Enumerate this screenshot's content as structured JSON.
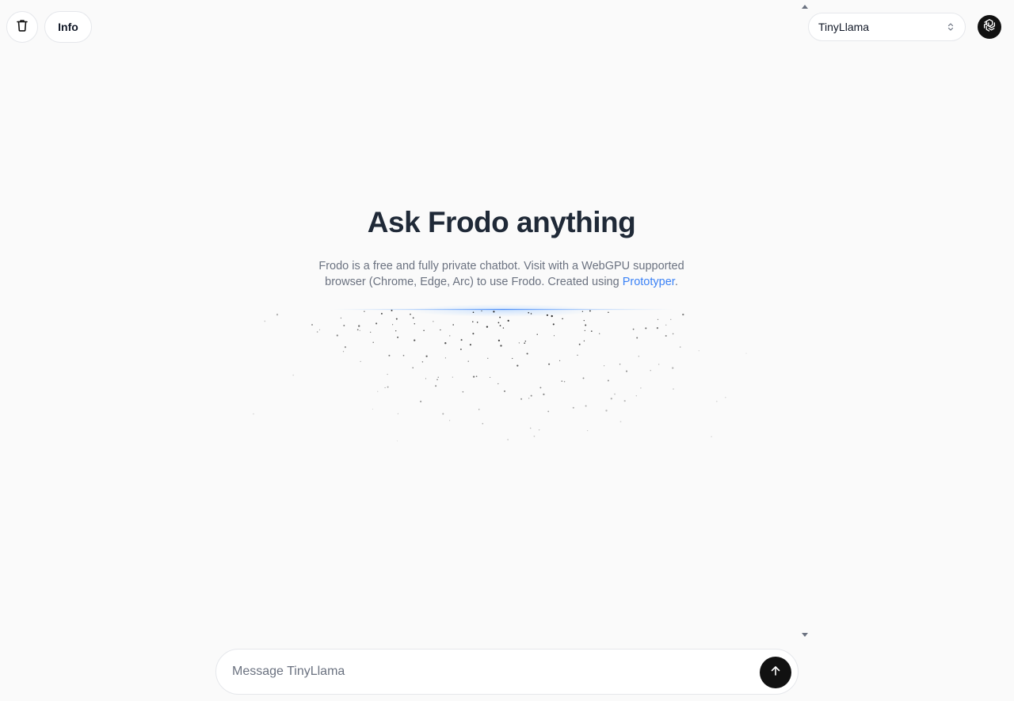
{
  "toolbar": {
    "clear_icon": "trash-icon",
    "info_label": "Info"
  },
  "model_selector": {
    "selected": "TinyLlama",
    "arrows_icon": "chevron-up-down-icon"
  },
  "account": {
    "avatar_icon": "openai-logo-icon"
  },
  "hero": {
    "title": "Ask Frodo anything",
    "subtitle_text": "Frodo is a free and fully private chatbot. Visit with a WebGPU supported browser (Chrome, Edge, Arc) to use Frodo. Created using ",
    "link_label": "Prototyper",
    "trailing": "."
  },
  "composer": {
    "placeholder": "Message TinyLlama",
    "value": "",
    "send_icon": "arrow-up-icon"
  },
  "colors": {
    "background": "#fafafa",
    "link": "#3b82f6",
    "send_button": "#111111"
  }
}
